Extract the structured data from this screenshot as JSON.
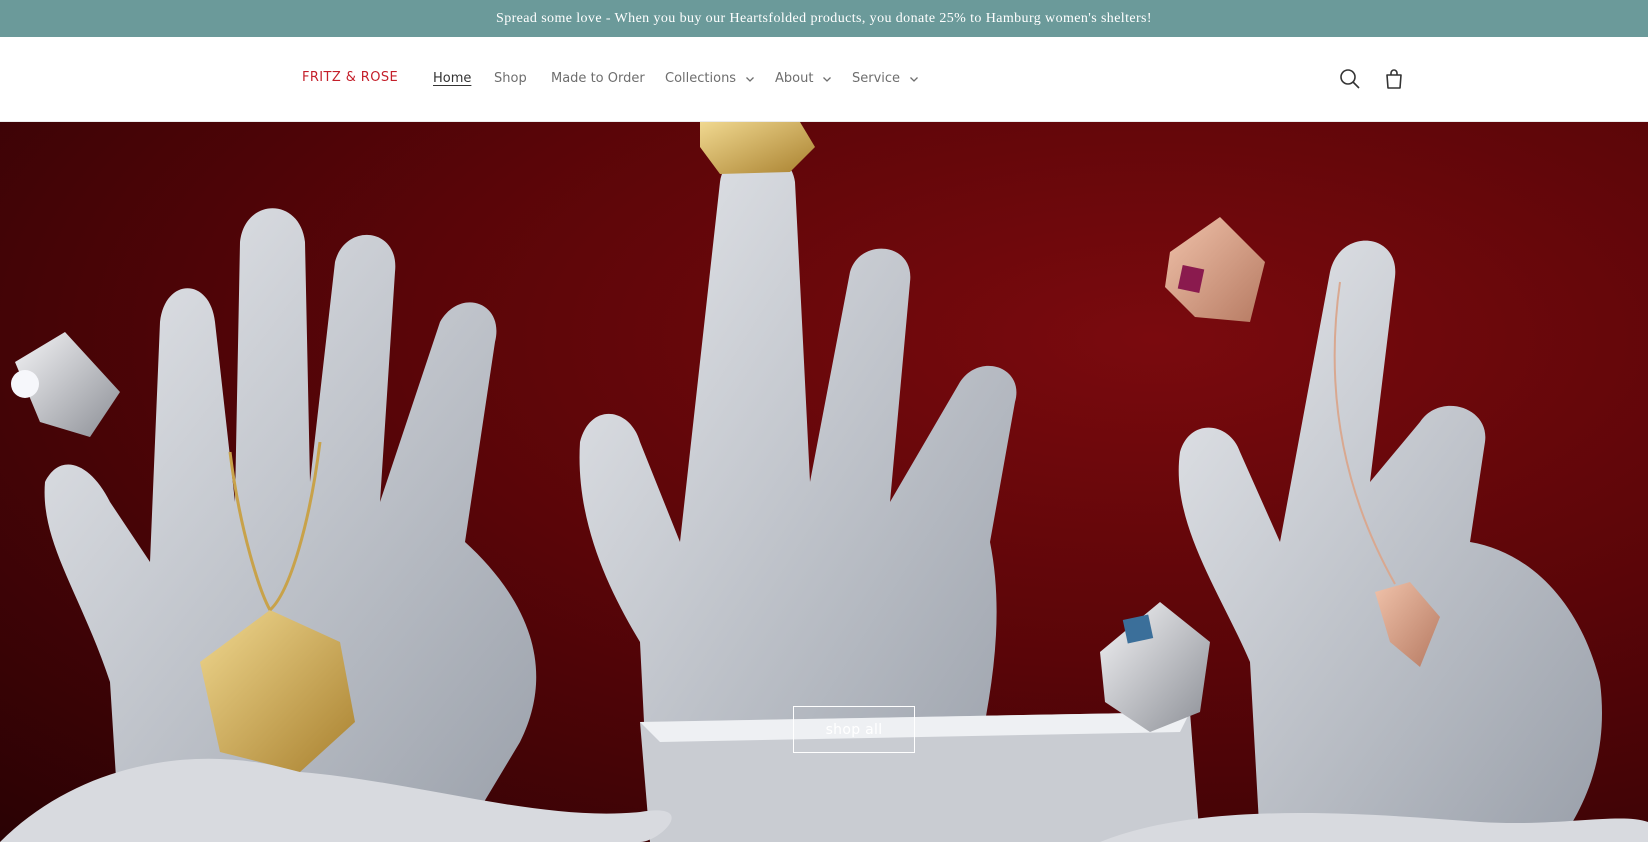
{
  "announcement": {
    "text": "Spread some love - When you buy our Heartsfolded products, you donate 25% to Hamburg women's shelters!"
  },
  "header": {
    "logo": "FRITZ & ROSE",
    "nav": [
      {
        "label": "Home",
        "active": true
      },
      {
        "label": "Shop"
      },
      {
        "label": "Made to Order"
      },
      {
        "label": "Collections",
        "dropdown": true
      },
      {
        "label": "About",
        "dropdown": true
      },
      {
        "label": "Service",
        "dropdown": true
      }
    ],
    "icons": [
      "search-icon",
      "cart-icon"
    ]
  },
  "hero": {
    "cta_label": "shop all"
  },
  "colors": {
    "announcement_bg": "#6b9a9a",
    "logo": "#c41f2a",
    "hero_bg": "#5a0508"
  }
}
